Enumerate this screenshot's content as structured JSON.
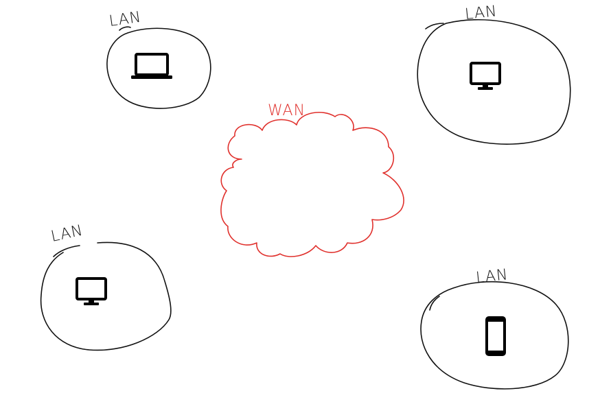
{
  "colors": {
    "lan_stroke": "#111111",
    "wan_stroke": "#e0302c",
    "icon_fill": "#000000",
    "background": "#ffffff"
  },
  "wan": {
    "label": "WAN"
  },
  "lans": [
    {
      "label": "LAN",
      "device": "laptop-icon"
    },
    {
      "label": "LAN",
      "device": "desktop-monitor-icon"
    },
    {
      "label": "LAN",
      "device": "desktop-monitor-icon"
    },
    {
      "label": "LAN",
      "device": "smartphone-icon"
    }
  ]
}
